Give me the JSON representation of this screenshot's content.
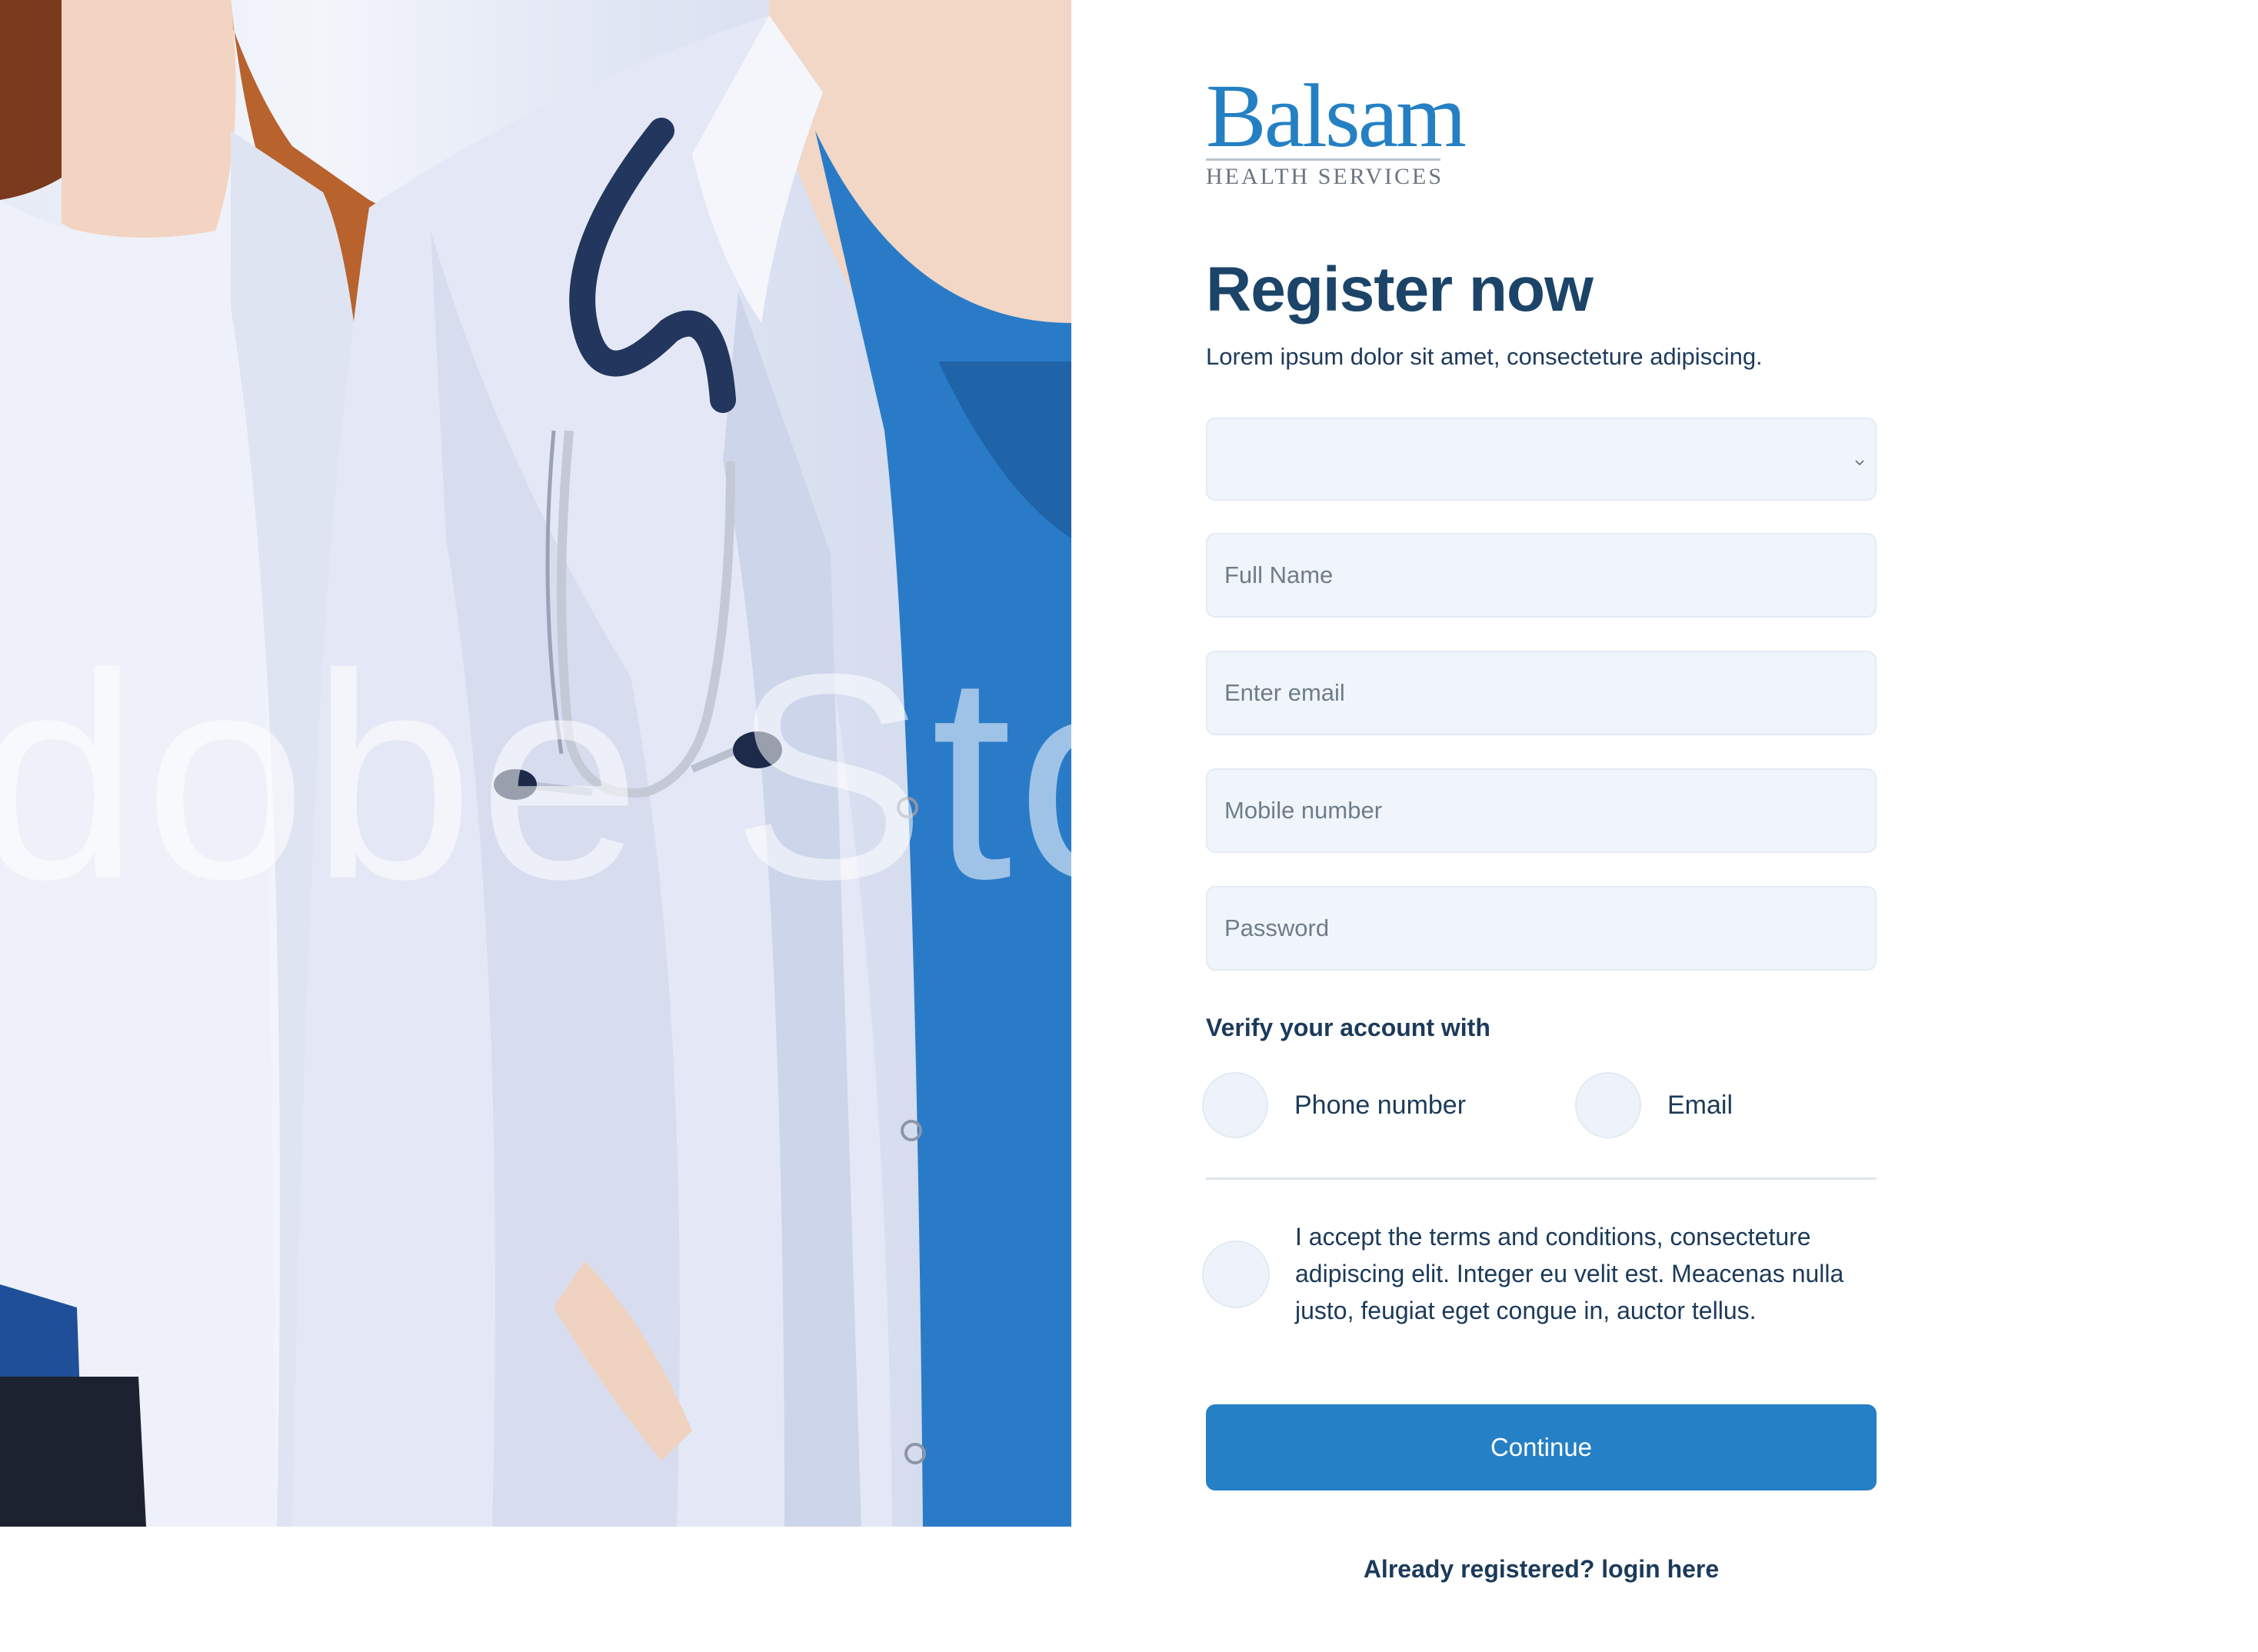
{
  "brand": {
    "logo_word": "Balsam",
    "logo_subtitle": "HEALTH SERVICES"
  },
  "image": {
    "watermark": "dobe Stoc"
  },
  "form": {
    "title": "Register now",
    "subtitle": "Lorem ipsum dolor sit amet, consecteture adipiscing.",
    "select": {
      "value": ""
    },
    "fields": {
      "full_name": {
        "placeholder": "Full Name"
      },
      "email": {
        "placeholder": "Enter email"
      },
      "mobile": {
        "placeholder": "Mobile number"
      },
      "password": {
        "placeholder": "Password"
      }
    },
    "verify": {
      "label": "Verify your account with",
      "options": [
        "Phone number",
        "Email"
      ]
    },
    "terms": "I accept the terms and conditions, consecteture adipiscing elit. Integer eu velit est. Meacenas nulla justo, feugiat eget congue in, auctor tellus.",
    "continue_label": "Continue",
    "login_link": "Already registered? login here"
  },
  "colors": {
    "primary": "#2580c6",
    "heading": "#1c4468",
    "field_bg": "#f0f5fc"
  },
  "icons": {
    "select_chevron": "chevron-down-icon"
  }
}
